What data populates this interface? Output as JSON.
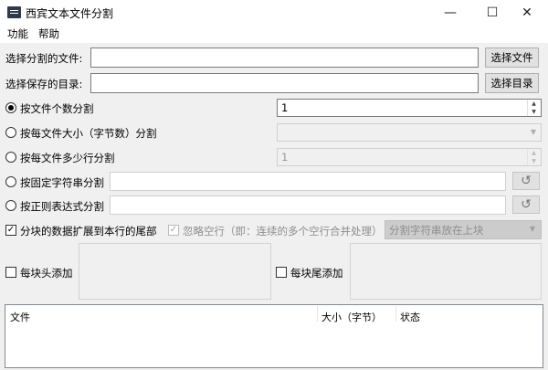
{
  "window": {
    "title": "西宾文本文件分割",
    "minimize_glyph": "—",
    "maximize_glyph": "☐",
    "close_glyph": "✕"
  },
  "menu": {
    "items": [
      "功能",
      "帮助"
    ]
  },
  "select_file": {
    "label": "选择分割的文件:",
    "value": "",
    "button": "选择文件"
  },
  "save_dir": {
    "label": "选择保存的目录:",
    "value": "",
    "button": "选择目录"
  },
  "options": {
    "by_count": {
      "label": "按文件个数分割",
      "value": "1",
      "selected": true
    },
    "by_size": {
      "label": "按每文件大小（字节数）分割",
      "value": ""
    },
    "by_lines": {
      "label": "按每文件多少行分割",
      "value": "1"
    },
    "by_string": {
      "label": "按固定字符串分割",
      "value": ""
    },
    "by_regex": {
      "label": "按正则表达式分割",
      "value": ""
    }
  },
  "extend_block": {
    "label": "分块的数据扩展到本行的尾部",
    "checked": true
  },
  "ignore_empty": {
    "label": "忽略空行（即：连续的多个空行合并处理）",
    "checked": true
  },
  "split_position": {
    "selected": "分割字符串放在上块"
  },
  "header": {
    "label": "每块头添加",
    "checked": false
  },
  "footer": {
    "label": "每块尾添加",
    "checked": false
  },
  "table": {
    "columns": [
      "文件",
      "大小（字节）",
      "状态"
    ]
  },
  "icons": {
    "check": "✓",
    "history": "↺",
    "arrow_up": "▲",
    "arrow_down": "▼"
  }
}
